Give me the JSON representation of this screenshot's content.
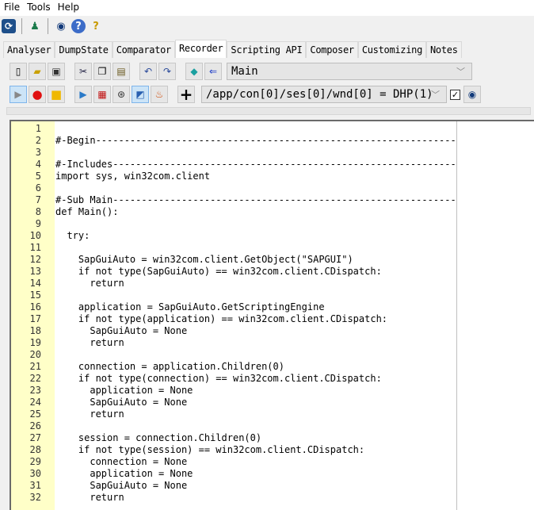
{
  "menubar": {
    "items": [
      {
        "label": "File"
      },
      {
        "label": "Tools"
      },
      {
        "label": "Help"
      }
    ]
  },
  "iconbar": {
    "icons": [
      "refresh-icon",
      "user-icon",
      "eye-icon",
      "help-icon",
      "context-help-icon"
    ]
  },
  "tabs": [
    {
      "label": "Analyser"
    },
    {
      "label": "DumpState"
    },
    {
      "label": "Comparator"
    },
    {
      "label": "Recorder",
      "active": true
    },
    {
      "label": "Scripting API"
    },
    {
      "label": "Composer"
    },
    {
      "label": "Customizing"
    },
    {
      "label": "Notes"
    }
  ],
  "recorder": {
    "toolbar1": {
      "icons": [
        "new-file-icon",
        "open-folder-icon",
        "save-icon",
        "cut-icon",
        "copy-icon",
        "paste-icon",
        "undo-icon",
        "redo-icon",
        "eraser-icon",
        "insert-icon"
      ],
      "combo_value": "Main"
    },
    "toolbar2": {
      "icons": [
        "play-icon",
        "record-icon",
        "stop-icon",
        "powershell-icon",
        "vbscript-icon",
        "autoit-icon",
        "python-icon",
        "java-icon",
        "add-icon"
      ],
      "path_value": "/app/con[0]/ses[0]/wnd[0] = DHP(1)",
      "checkbox_checked": true,
      "checkbox_mark": "✓",
      "eye_icon": "eye-icon"
    },
    "editor": {
      "lines": [
        "",
        "#-Begin-----------------------------------------------------------------------",
        "",
        "#-Includes--------------------------------------------------------------------",
        "import sys, win32com.client",
        "",
        "#-Sub Main--------------------------------------------------------------------",
        "def Main():",
        "",
        "  try:",
        "",
        "    SapGuiAuto = win32com.client.GetObject(\"SAPGUI\")",
        "    if not type(SapGuiAuto) == win32com.client.CDispatch:",
        "      return",
        "",
        "    application = SapGuiAuto.GetScriptingEngine",
        "    if not type(application) == win32com.client.CDispatch:",
        "      SapGuiAuto = None",
        "      return",
        "",
        "    connection = application.Children(0)",
        "    if not type(connection) == win32com.client.CDispatch:",
        "      application = None",
        "      SapGuiAuto = None",
        "      return",
        "",
        "    session = connection.Children(0)",
        "    if not type(session) == win32com.client.CDispatch:",
        "      connection = None",
        "      application = None",
        "      SapGuiAuto = None",
        "      return"
      ]
    }
  }
}
